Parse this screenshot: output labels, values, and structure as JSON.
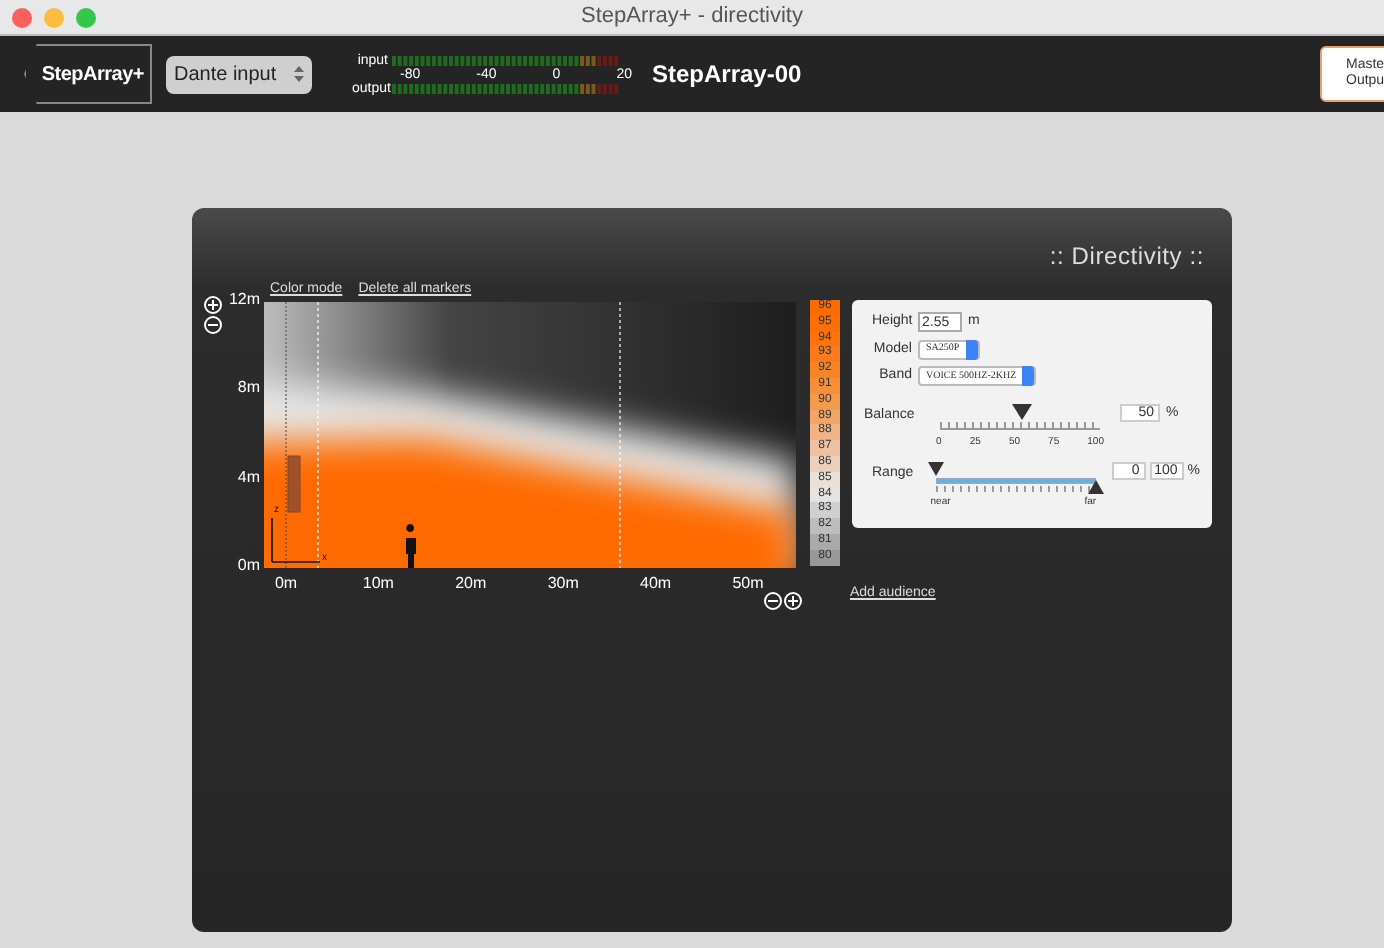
{
  "window": {
    "title": "StepArray+ - directivity"
  },
  "toolbar": {
    "logo": "StepArray+",
    "source_select": {
      "value": "Dante input"
    },
    "meter": {
      "input_label": "input",
      "output_label": "output",
      "scale": [
        "-80",
        "-40",
        "0",
        "20"
      ]
    },
    "device_name": "StepArray-00",
    "master_button": {
      "lines": [
        "Maste",
        "Outpu"
      ]
    }
  },
  "panel": {
    "title": ":: Directivity ::",
    "links": [
      {
        "label": "Color mode"
      },
      {
        "label": "Delete all markers"
      }
    ],
    "y_labels": [
      "12m",
      "8m",
      "4m",
      "0m"
    ],
    "x_labels": [
      "0m",
      "10m",
      "20m",
      "30m",
      "40m",
      "50m"
    ],
    "axis_labels": {
      "z": "z",
      "x": "x"
    },
    "color_scale": [
      {
        "label": "96",
        "color": "#ff6a00"
      },
      {
        "label": "95",
        "color": "#ff6e06"
      },
      {
        "label": "94",
        "color": "#ff730d"
      },
      {
        "label": "93",
        "color": "#fb7a1a"
      },
      {
        "label": "92",
        "color": "#f88428"
      },
      {
        "label": "91",
        "color": "#f68f3a"
      },
      {
        "label": "90",
        "color": "#f39a4c"
      },
      {
        "label": "89",
        "color": "#f1a666"
      },
      {
        "label": "88",
        "color": "#efb386"
      },
      {
        "label": "87",
        "color": "#edc2a2"
      },
      {
        "label": "86",
        "color": "#ecd0bc"
      },
      {
        "label": "85",
        "color": "#e9e0d8"
      },
      {
        "label": "84",
        "color": "#e4e4e4"
      },
      {
        "label": "83",
        "color": "#cfcfcf"
      },
      {
        "label": "82",
        "color": "#bdbdbd"
      },
      {
        "label": "81",
        "color": "#aaaaaa"
      },
      {
        "label": "80",
        "color": "#989898"
      }
    ],
    "add_audience": "Add audience",
    "settings": {
      "height": {
        "label": "Height",
        "value": "2.55",
        "unit": "m"
      },
      "model": {
        "label": "Model",
        "value": "SA250P"
      },
      "band": {
        "label": "Band",
        "value": "VOICE 500HZ-2KHZ"
      },
      "balance": {
        "label": "Balance",
        "level": 0.5,
        "ticks": [
          "0",
          "25",
          "50",
          "75",
          "100"
        ],
        "reading": "50",
        "unit": "%"
      },
      "range": {
        "label": "Range",
        "start": {
          "level": 0
        },
        "end": {
          "level": 1
        },
        "near": "near",
        "far": "far",
        "start_reading": "0",
        "end_reading": "100",
        "unit": "%"
      }
    }
  }
}
